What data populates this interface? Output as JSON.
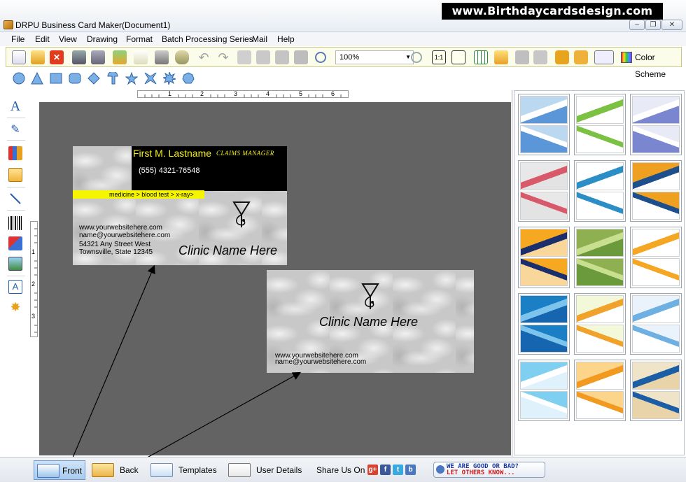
{
  "window": {
    "title": "DRPU Business Card Maker(Document1)",
    "banner": "www.Birthdaycardsdesign.com",
    "controls": {
      "minimize": "–",
      "restore": "❐",
      "close": "✕"
    }
  },
  "menu": [
    "File",
    "Edit",
    "View",
    "Drawing",
    "Format",
    "Batch Processing Series",
    "Mail",
    "Help"
  ],
  "toolbar": {
    "zoom_value": "100%",
    "fit_label": "1:1",
    "color_scheme_label": "Color Scheme",
    "icons": [
      "new-icon",
      "open-icon",
      "close-doc-icon",
      "save-icon",
      "save-as-icon",
      "import-icon",
      "properties-icon",
      "print-icon",
      "database-icon",
      "undo-icon",
      "redo-icon",
      "copy-icon",
      "cut-icon",
      "paste-icon",
      "paste-special-icon",
      "zoom-in-icon",
      "zoom-out-icon",
      "actual-size-icon",
      "fit-page-icon",
      "grid-icon",
      "mail-icon",
      "bring-front-icon",
      "send-back-icon",
      "lock-icon",
      "unlock-icon",
      "view-icon",
      "color-scheme-icon"
    ]
  },
  "shapes": [
    "ellipse-icon",
    "triangle-icon",
    "rectangle-icon",
    "rounded-rectangle-icon",
    "diamond-icon",
    "arc-icon",
    "star-icon",
    "star4-icon",
    "burst-icon",
    "polygon-icon"
  ],
  "left_tools": [
    "text-tool-icon",
    "pencil-tool-icon",
    "library-icon",
    "image-icon",
    "line-tool-icon",
    "barcode-icon",
    "watermark-icon",
    "picture-icon",
    "word-art-icon",
    "signature-icon"
  ],
  "rulers": {
    "horizontal": [
      "1",
      "2",
      "3",
      "4",
      "5",
      "6"
    ],
    "vertical": [
      "1",
      "2",
      "3"
    ]
  },
  "front_card": {
    "name": "First M. Lastname",
    "job_title": "CLAIMS MANAGER",
    "phone": "(555) 4321-76548",
    "tagline": "medicine > blood test > x-ray>",
    "website": "www.yourwebsitehere.com",
    "email": "name@yourwebsitehere.com",
    "address1": "54321 Any Street West",
    "address2": "Townsville, State 12345",
    "clinic": "Clinic Name Here"
  },
  "back_card": {
    "clinic": "Clinic Name Here",
    "website": "www.yourwebsitehere.com",
    "email": "name@yourwebsitehere.com"
  },
  "templates": [
    {
      "top": "#bcd8f0",
      "bottom": "#5b97d8",
      "accent": "#ffffff"
    },
    {
      "top": "#ffffff",
      "bottom": "#ffffff",
      "accent": "#7bc142"
    },
    {
      "top": "#e8eaf5",
      "bottom": "#7a86cf",
      "accent": "#ffffff"
    },
    {
      "top": "#e8e8e8",
      "bottom": "#e3e3e3",
      "accent": "#d85a6a"
    },
    {
      "top": "#ffffff",
      "bottom": "#ffffff",
      "accent": "#2c8ec6"
    },
    {
      "top": "#f0a020",
      "bottom": "#ffffff",
      "accent": "#1d4f8c"
    },
    {
      "top": "#f7a821",
      "bottom": "#f9d69a",
      "accent": "#1a2f6b"
    },
    {
      "top": "#8fb050",
      "bottom": "#6a9a3b",
      "accent": "#c7df8f"
    },
    {
      "top": "#ffffff",
      "bottom": "#ffffff",
      "accent": "#f5a623"
    },
    {
      "top": "#1a7fc4",
      "bottom": "#1565b0",
      "accent": "#7cc4ec"
    },
    {
      "top": "#f3f9d8",
      "bottom": "#ffffff",
      "accent": "#f1a22a"
    },
    {
      "top": "#eaf3fb",
      "bottom": "#ffffff",
      "accent": "#6fb0e3"
    },
    {
      "top": "#7fd0f0",
      "bottom": "#dff2fb",
      "accent": "#ffffff"
    },
    {
      "top": "#fcd48a",
      "bottom": "#ffffff",
      "accent": "#f29a1f"
    },
    {
      "top": "#f0e4c8",
      "bottom": "#e9d3a8",
      "accent": "#1c5ea6"
    }
  ],
  "bottom_tabs": {
    "front": "Front",
    "back": "Back",
    "templates": "Templates",
    "user_details": "User Details",
    "share_label": "Share Us On :",
    "share_icons": {
      "google": "g+",
      "facebook": "f",
      "twitter": "t",
      "other": "b"
    },
    "feedback_line1": "WE ARE GOOD OR BAD?",
    "feedback_line2": "LET OTHERS KNOW..."
  },
  "colors": {
    "canvas": "#636363",
    "name_yellow": "#f2ef1d",
    "strip_yellow": "#f5f500",
    "toolbar_bg": "#fbfdea"
  }
}
